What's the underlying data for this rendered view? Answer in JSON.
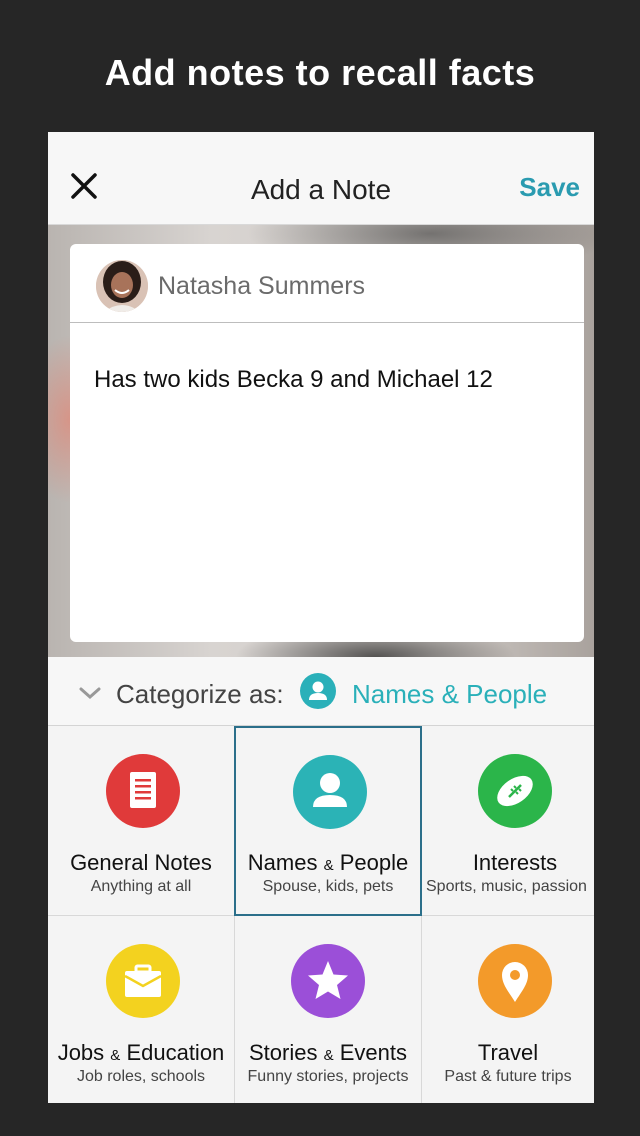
{
  "headline": "Add notes to recall facts",
  "navbar": {
    "title": "Add a Note",
    "save_label": "Save",
    "close_icon": "close-icon"
  },
  "note": {
    "contact_name": "Natasha Summers",
    "text": "Has two kids Becka 9 and Michael 12"
  },
  "categorize": {
    "label": "Categorize as:",
    "selected": "Names & People",
    "selected_icon": "person-icon"
  },
  "categories": [
    {
      "title": "General Notes",
      "sub": "Anything at all",
      "icon": "document-icon",
      "color": "#e03a3a"
    },
    {
      "title_a": "Names",
      "title_amp": "&",
      "title_b": "People",
      "sub": "Spouse, kids, pets",
      "icon": "person-icon",
      "color": "#2bb3b6",
      "selected": true
    },
    {
      "title": "Interests",
      "sub": "Sports, music, passion",
      "icon": "football-icon",
      "color": "#2bb54a"
    },
    {
      "title_a": "Jobs",
      "title_amp": "&",
      "title_b": "Education",
      "sub": "Job roles, schools",
      "icon": "briefcase-icon",
      "color": "#f3d21f"
    },
    {
      "title_a": "Stories",
      "title_amp": "&",
      "title_b": "Events",
      "sub": "Funny stories, projects",
      "icon": "star-icon",
      "color": "#9b4fd8"
    },
    {
      "title": "Travel",
      "sub": "Past & future trips",
      "icon": "location-pin-icon",
      "color": "#f39a2a"
    }
  ],
  "colors": {
    "accent": "#2a9bb0",
    "teal": "#2ab0b9",
    "background": "#262626"
  }
}
